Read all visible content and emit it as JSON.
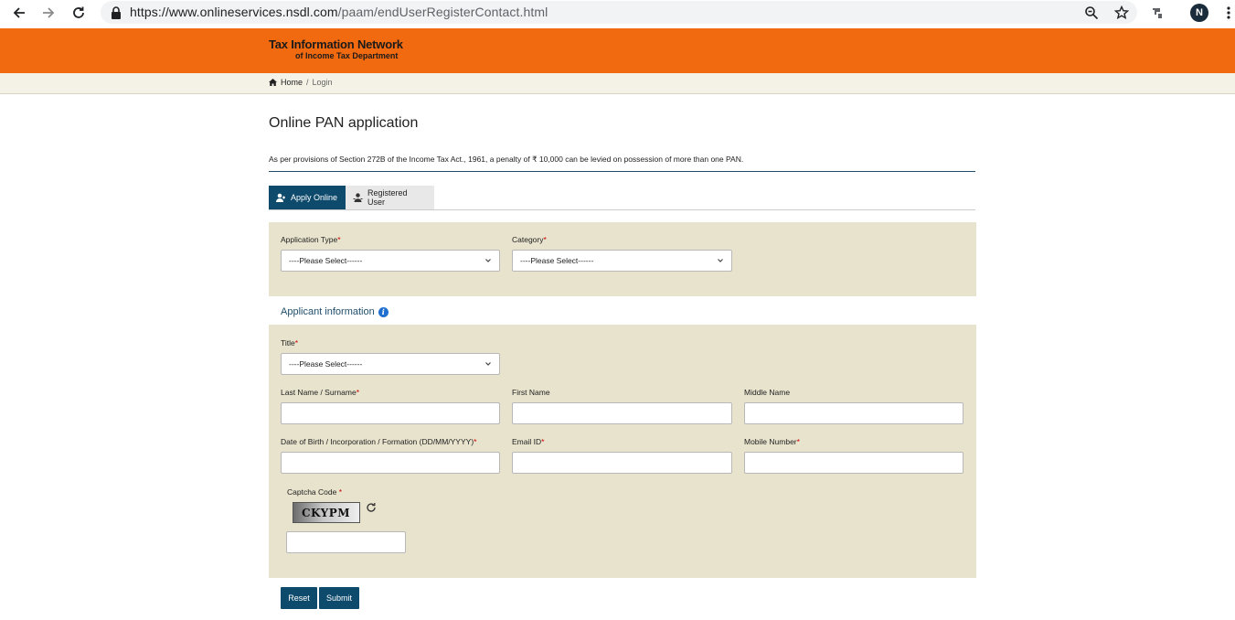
{
  "browser": {
    "url_host": "https://www.onlineservices.nsdl.com",
    "url_path": "/paam/endUserRegisterContact.html",
    "profile_initial": "N"
  },
  "header": {
    "logo_line1": "Tax Information Network",
    "logo_line2": "of Income Tax Department"
  },
  "breadcrumb": {
    "home": "Home",
    "separator": "/",
    "current": "Login"
  },
  "page": {
    "title": "Online PAN application",
    "notice": "As per provisions of Section 272B of the Income Tax Act., 1961, a penalty of ₹ 10,000 can be levied on possession of more than one PAN."
  },
  "tabs": [
    {
      "label": "Apply Online",
      "active": true
    },
    {
      "label": "Registered User",
      "active": false
    }
  ],
  "form": {
    "application_type": {
      "label": "Application Type",
      "value": "----Please Select------"
    },
    "category": {
      "label": "Category",
      "value": "----Please Select------"
    },
    "applicant_section_title": "Applicant information",
    "title": {
      "label": "Title",
      "value": "----Please Select------"
    },
    "last_name": {
      "label": "Last Name / Surname",
      "value": ""
    },
    "first_name": {
      "label": "First Name",
      "value": ""
    },
    "middle_name": {
      "label": "Middle Name",
      "value": ""
    },
    "dob": {
      "label": "Date of Birth / Incorporation / Formation (DD/MM/YYYY)",
      "value": ""
    },
    "email": {
      "label": "Email ID",
      "value": ""
    },
    "mobile": {
      "label": "Mobile Number",
      "value": ""
    },
    "captcha": {
      "label": "Captcha Code ",
      "image_text": "CKYPM",
      "value": ""
    },
    "required_mark": "*"
  },
  "buttons": {
    "reset": "Reset",
    "submit": "Submit"
  },
  "colors": {
    "header_orange": "#f26a10",
    "primary_blue": "#0e4a6c",
    "panel_beige": "#e8e3cd",
    "required_red": "#c00000"
  }
}
